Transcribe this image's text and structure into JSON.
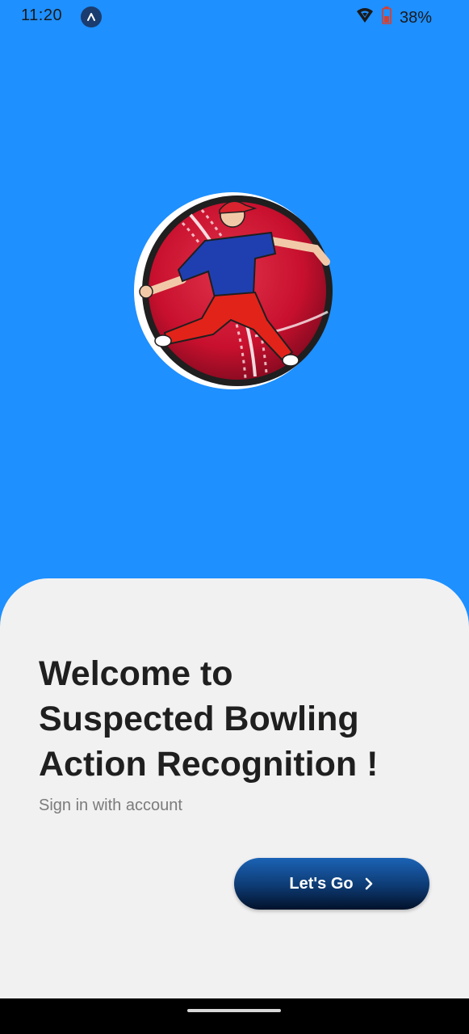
{
  "status_bar": {
    "time": "11:20",
    "battery": "38%",
    "icons": [
      "app-notification-icon",
      "wifi-icon",
      "battery-icon"
    ]
  },
  "welcome": {
    "title_lines": [
      "Welcome to",
      "Suspected Bowling",
      "Action Recognition !"
    ],
    "subtitle": "Sign in with account"
  },
  "actions": {
    "lets_go_label": "Let's Go"
  },
  "colors": {
    "background": "#1e90ff",
    "sheet": "#f1f1f2",
    "button_top": "#1b63b5",
    "button_bottom": "#02122a",
    "title": "#1f1f1f",
    "subtitle": "#7b7b7b"
  }
}
